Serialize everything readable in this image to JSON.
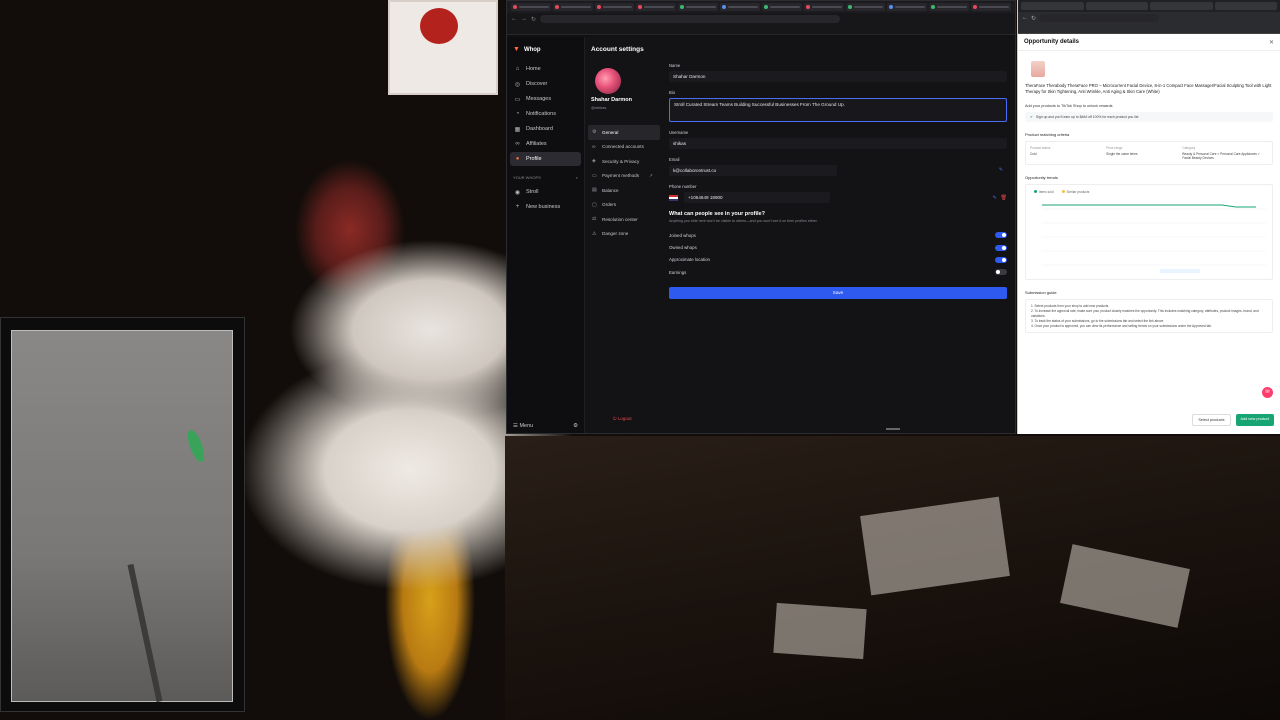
{
  "whop": {
    "brand": "Whop",
    "nav": [
      {
        "label": "Home",
        "icon": "home-icon"
      },
      {
        "label": "Discover",
        "icon": "compass-icon"
      },
      {
        "label": "Messages",
        "icon": "chat-icon"
      },
      {
        "label": "Notifications",
        "icon": "bell-icon"
      },
      {
        "label": "Dashboard",
        "icon": "dashboard-icon"
      },
      {
        "label": "Affiliates",
        "icon": "link-icon"
      },
      {
        "label": "Profile",
        "icon": "user-icon",
        "active": true
      }
    ],
    "section_label": "YOUR WHOPS",
    "whops": [
      {
        "label": "Stroll"
      },
      {
        "label": "New business"
      }
    ],
    "menu_label": "Menu",
    "settings": {
      "title": "Account settings",
      "profile_name": "Shahar Darmon",
      "profile_handle": "@shikas",
      "nav": [
        {
          "label": "General",
          "active": true
        },
        {
          "label": "Connected accounts"
        },
        {
          "label": "Security & Privacy"
        },
        {
          "label": "Payment methods"
        },
        {
          "label": "Balance"
        },
        {
          "label": "Orders"
        },
        {
          "label": "Resolution center"
        },
        {
          "label": "Danger zone"
        }
      ],
      "logout_label": "Logout",
      "fields": {
        "name_label": "Name",
        "name_value": "Shahar Darmon",
        "bio_label": "Bio",
        "bio_value": "Stroll Curated Stream Teams Building Successful Businesses From The Ground Up.",
        "username_label": "Username",
        "username_value": "shikas",
        "email_label": "Email",
        "email_value": "k@collaborontrust.co",
        "phone_label": "Phone number",
        "phone_value": "+1054649 18900"
      },
      "visibility_title": "What can people see in your profile?",
      "visibility_sub": "Anything you hide here won't be visible to others—and you won't see it on their profiles either.",
      "toggles": [
        {
          "label": "Joined whops",
          "on": true
        },
        {
          "label": "Owned whops",
          "on": true
        },
        {
          "label": "Approximate location",
          "on": true
        },
        {
          "label": "Earnings",
          "on": false
        }
      ],
      "save_label": "Save"
    }
  },
  "opportunity": {
    "title": "Opportunity details",
    "product_title": "TheraFace Therabody TheraFace PRO – Microcurrent Facial Device, 8-in-1 Compact Face Massager/Facial Sculpting Tool with Light Therapy for Skin Tightening, Anti Wrinkle, Anti Aging & Skin Care (White)",
    "add_products_line": "Add your products to TikTok Shop to unlock rewards",
    "banner_text": "Sign up and you'll earn up to $### off 100% for each product you list",
    "criteria_heading": "Product matching criteria",
    "criteria": [
      {
        "head": "Product status",
        "value": "Cold"
      },
      {
        "head": "Price range",
        "value": "Single the same items"
      },
      {
        "head": "Category",
        "value": "Beauty & Personal Care > Personal Care Appliances > Facial Beauty Devices"
      }
    ],
    "trends_heading": "Opportunity trends",
    "legend": [
      "Items sold",
      "Similar products"
    ],
    "guide_heading": "Submission guide",
    "guide_lines": [
      "1. Select products from your shop to add new products.",
      "2. To increase the approval rate, make sure your product closely matches the opportunity. This includes matching category, attributes, product images, brand, and variations.",
      "3. To track the status of your submissions, go to the submissions tab and select the link above.",
      "4. Once your product is approved, you can view its performance and selling trends on your submissions under the Approved tab."
    ],
    "select_products_label": "Select products",
    "add_new_product_label": "Add new product"
  },
  "colors": {
    "accent_blue": "#2f5af0",
    "whop_orange": "#ff6a3d",
    "tiktok_green": "#17a673",
    "danger_red": "#e5484d"
  }
}
